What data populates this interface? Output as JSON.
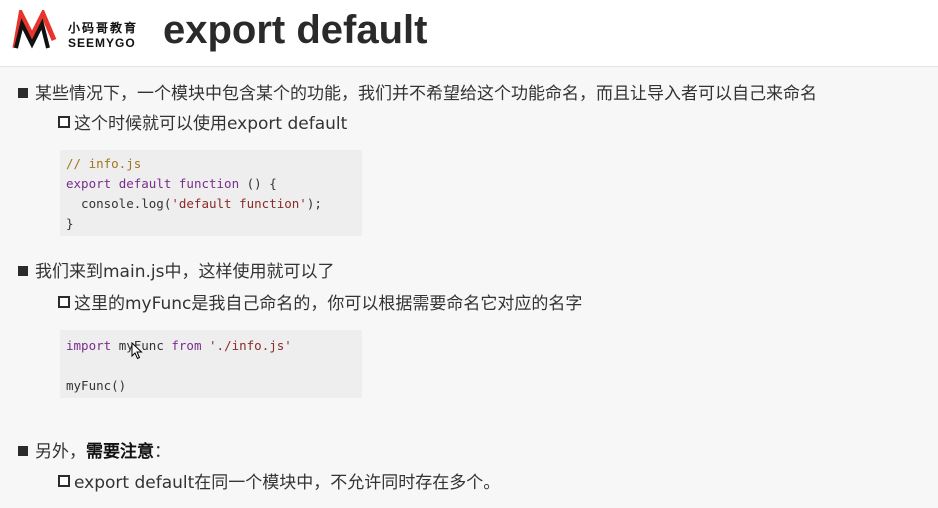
{
  "logo": {
    "text_cn": "小码哥教育",
    "text_en": "SEEMYGO",
    "color": "#e8352b"
  },
  "title": "export default",
  "sections": [
    {
      "text": "某些情况下，一个模块中包含某个的功能，我们并不希望给这个功能命名，而且让导入者可以自己来命名",
      "sub": "这个时候就可以使用export default"
    },
    {
      "text": "我们来到main.js中，这样使用就可以了",
      "sub": "这里的myFunc是我自己命名的，你可以根据需要命名它对应的名字"
    },
    {
      "text_prefix": "另外，",
      "text_strong": "需要注意",
      "text_suffix": "：",
      "sub": "export default在同一个模块中，不允许同时存在多个。"
    }
  ],
  "code1": {
    "comment": "// info.js",
    "kw_export": "export",
    "kw_default": "default",
    "kw_function": "function",
    "paren_open": " () {",
    "call_prefix": "  console.log(",
    "str": "'default function'",
    "call_suffix": ");",
    "close": "}"
  },
  "code2": {
    "kw_import": "import",
    "ident": "myFunc",
    "kw_from": "from",
    "str": "'./info.js'",
    "call": "myFunc()"
  }
}
